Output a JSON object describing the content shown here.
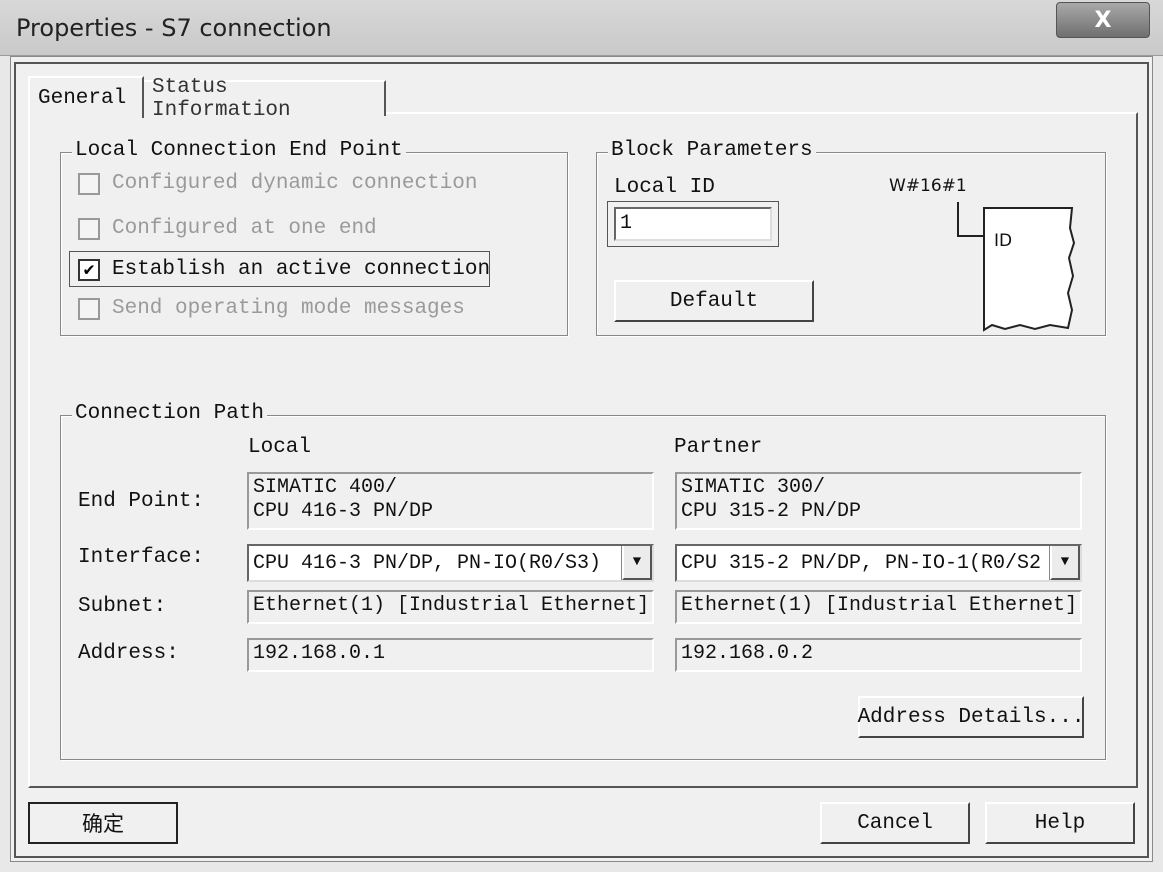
{
  "window": {
    "title": "Properties - S7 connection",
    "close_label": "X"
  },
  "tabs": [
    {
      "label": "General",
      "active": true
    },
    {
      "label": "Status Information",
      "active": false
    }
  ],
  "local_endpoint": {
    "legend": "Local Connection End Point",
    "options": [
      {
        "label": "Configured dynamic connection",
        "checked": false,
        "enabled": false
      },
      {
        "label": "Configured at one end",
        "checked": false,
        "enabled": false
      },
      {
        "label": "Establish an active connection",
        "checked": true,
        "enabled": true
      },
      {
        "label": "Send operating mode messages",
        "checked": false,
        "enabled": false
      }
    ]
  },
  "block_params": {
    "legend": "Block Parameters",
    "local_id_label": "Local ID",
    "local_id_value": "1",
    "default_label": "Default",
    "diagram_value": "W#16#1",
    "diagram_id_label": "ID"
  },
  "connection_path": {
    "legend": "Connection Path",
    "col_local": "Local",
    "col_partner": "Partner",
    "end_point_label": "End Point:",
    "interface_label": "Interface:",
    "subnet_label": "Subnet:",
    "address_label": "Address:",
    "local": {
      "end_point_line1": "SIMATIC 400/",
      "end_point_line2": "CPU 416-3 PN/DP",
      "interface": "CPU 416-3 PN/DP, PN-IO(R0/S3)",
      "subnet": "Ethernet(1) [Industrial Ethernet]",
      "address": "192.168.0.1"
    },
    "partner": {
      "end_point_line1": "SIMATIC 300/",
      "end_point_line2": "CPU 315-2 PN/DP",
      "interface": "CPU 315-2 PN/DP, PN-IO-1(R0/S2",
      "subnet": "Ethernet(1) [Industrial Ethernet]",
      "address": "192.168.0.2"
    },
    "address_details_label": "Address Details..."
  },
  "footer": {
    "ok_label": "确定",
    "cancel_label": "Cancel",
    "help_label": "Help"
  }
}
